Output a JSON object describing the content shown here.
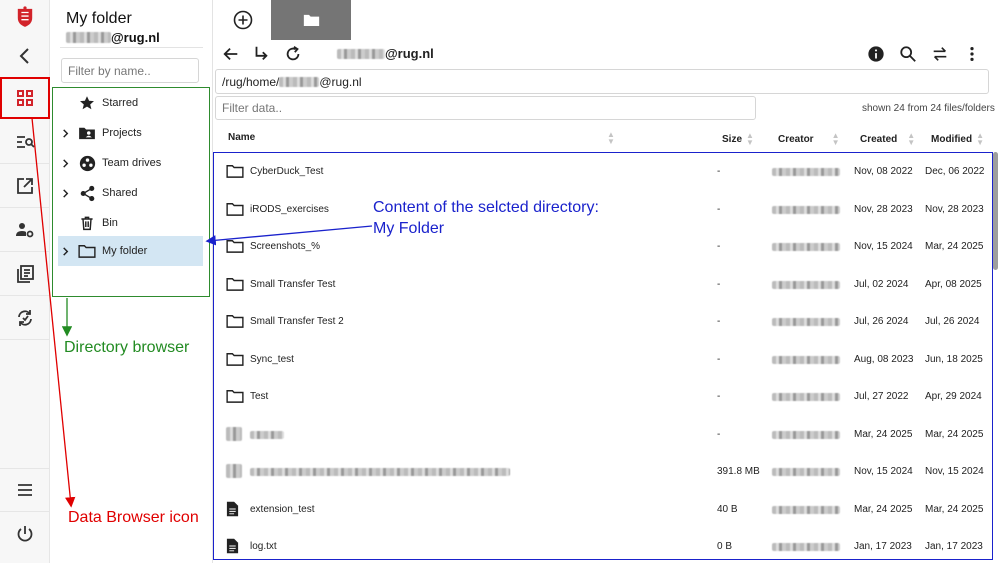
{
  "directory_panel": {
    "title": "My folder",
    "user_suffix": "@rug.nl",
    "filter_placeholder": "Filter by name..",
    "tree": [
      {
        "label": "Starred",
        "icon": "star-icon",
        "expandable": false,
        "selected": false
      },
      {
        "label": "Projects",
        "icon": "projects-folder-icon",
        "expandable": true,
        "selected": false
      },
      {
        "label": "Team drives",
        "icon": "team-drives-icon",
        "expandable": true,
        "selected": false
      },
      {
        "label": "Shared",
        "icon": "share-icon",
        "expandable": true,
        "selected": false
      },
      {
        "label": "Bin",
        "icon": "trash-icon",
        "expandable": false,
        "selected": false
      },
      {
        "label": "My folder",
        "icon": "folder-icon",
        "expandable": true,
        "selected": true
      }
    ]
  },
  "toolbar": {
    "user_suffix": "@rug.nl",
    "path_prefix": "/rug/home/",
    "path_suffix": "@rug.nl"
  },
  "file_list": {
    "filter_placeholder": "Filter data..",
    "shown_count": "shown 24 from 24 files/folders",
    "columns": {
      "name": "Name",
      "size": "Size",
      "creator": "Creator",
      "created": "Created",
      "modified": "Modified"
    },
    "rows": [
      {
        "type": "folder",
        "name": "CyberDuck_Test",
        "size": "-",
        "created": "Nov, 08 2022",
        "modified": "Dec, 06 2022"
      },
      {
        "type": "folder",
        "name": "iRODS_exercises",
        "size": "-",
        "created": "Nov, 28 2023",
        "modified": "Nov, 28 2023"
      },
      {
        "type": "folder",
        "name": "Screenshots_%",
        "size": "-",
        "created": "Nov, 15 2024",
        "modified": "Mar, 24 2025"
      },
      {
        "type": "folder",
        "name": "Small Transfer Test",
        "size": "-",
        "created": "Jul, 02 2024",
        "modified": "Apr, 08 2025"
      },
      {
        "type": "folder",
        "name": "Small Transfer Test 2",
        "size": "-",
        "created": "Jul, 26 2024",
        "modified": "Jul, 26 2024"
      },
      {
        "type": "folder",
        "name": "Sync_test",
        "size": "-",
        "created": "Aug, 08 2023",
        "modified": "Jun, 18 2025"
      },
      {
        "type": "folder",
        "name": "Test",
        "size": "-",
        "created": "Jul, 27 2022",
        "modified": "Apr, 29 2024"
      },
      {
        "type": "blurred",
        "name": "",
        "size": "-",
        "created": "Mar, 24 2025",
        "modified": "Mar, 24 2025"
      },
      {
        "type": "blurred-file",
        "name": "",
        "size": "391.8 MB",
        "created": "Nov, 15 2024",
        "modified": "Nov, 15 2024"
      },
      {
        "type": "file",
        "name": "extension_test",
        "size": "40 B",
        "created": "Mar, 24 2025",
        "modified": "Mar, 24 2025"
      },
      {
        "type": "file",
        "name": "log.txt",
        "size": "0 B",
        "created": "Jan, 17 2023",
        "modified": "Jan, 17 2023"
      }
    ]
  },
  "annotations": {
    "directory_browser": "Directory browser",
    "data_browser_icon": "Data Browser icon",
    "content_line1": "Content of the selcted directory:",
    "content_line2": "My Folder"
  },
  "colors": {
    "annotation_green": "#228b22",
    "annotation_red": "#e00000",
    "annotation_blue": "#1a22cc",
    "brand_red": "#d2232a",
    "selected_bg": "#d3e6f3"
  }
}
